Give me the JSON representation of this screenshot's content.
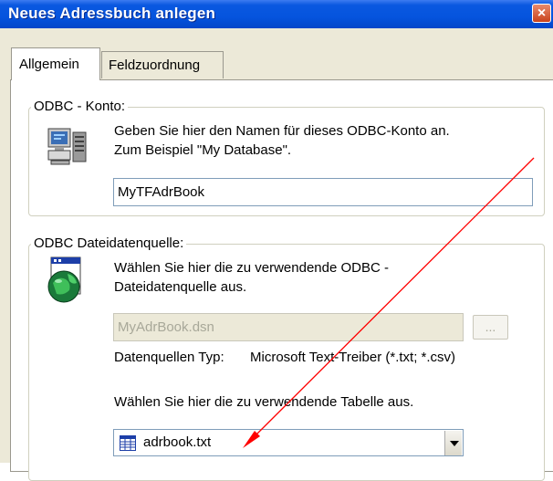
{
  "window": {
    "title": "Neues Adressbuch anlegen",
    "close_glyph": "×"
  },
  "tabs": [
    {
      "label": "Allgemein",
      "active": true
    },
    {
      "label": "Feldzuordnung",
      "active": false
    }
  ],
  "odbc_account": {
    "group_label": "ODBC - Konto:",
    "description_line1": "Geben Sie hier den Namen für dieses ODBC-Konto an.",
    "description_line2": "Zum Beispiel \"My Database\".",
    "name_value": "MyTFAdrBook",
    "icon": "computer-database-icon"
  },
  "odbc_file_source": {
    "group_label": "ODBC Dateidatenquelle:",
    "description_line1": "Wählen Sie hier die zu verwendende ODBC -",
    "description_line2": "Dateidatenquelle aus.",
    "dsn_value": "MyAdrBook.dsn",
    "browse_label": "...",
    "source_type_label": "Datenquellen Typ:",
    "source_type_value": "Microsoft Text-Treiber (*.txt; *.csv)",
    "table_prompt": "Wählen Sie hier die zu verwendende Tabelle aus.",
    "table_selected": "adrbook.txt",
    "icon": "globe-document-icon"
  },
  "colors": {
    "titlebar": "#0554de",
    "annotation_arrow": "#ff0000"
  }
}
